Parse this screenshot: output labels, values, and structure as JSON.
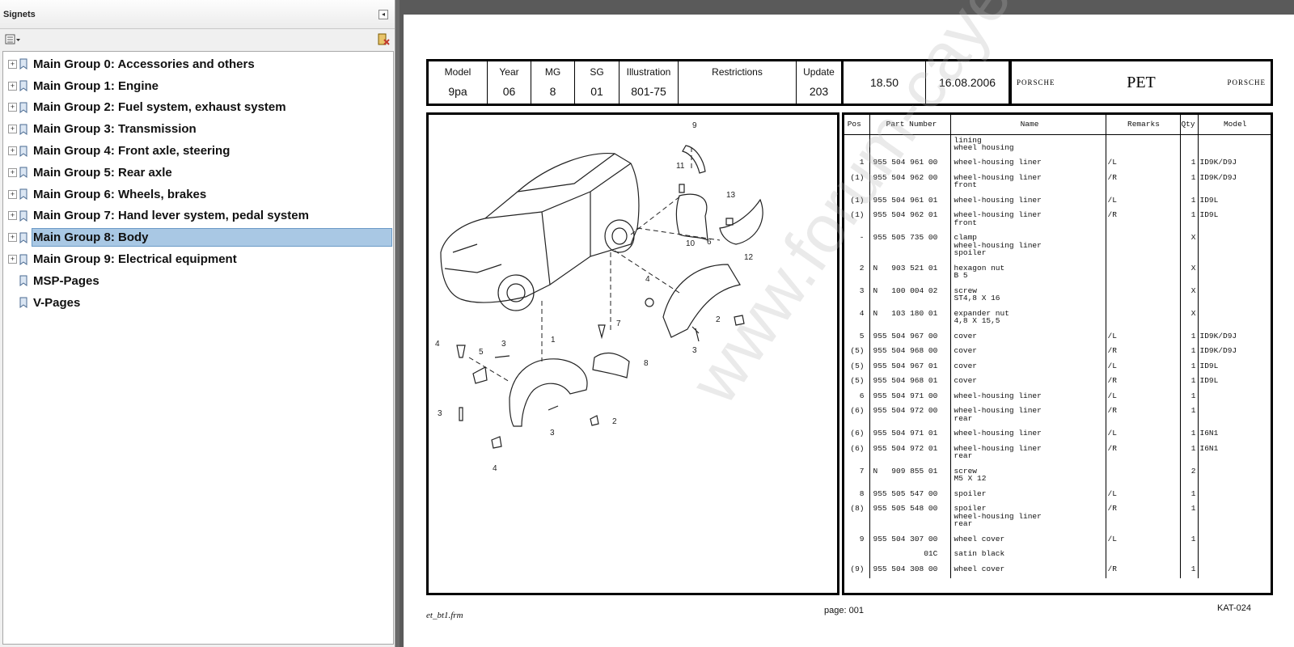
{
  "panel": {
    "title": "Signets",
    "collapse_glyph": "◂",
    "options_icon": "options-menu-icon",
    "delete_icon": "delete-bookmark-icon"
  },
  "bookmarks": [
    {
      "label": "Main Group 0: Accessories and others",
      "expandable": true,
      "selected": false
    },
    {
      "label": "Main Group 1: Engine",
      "expandable": true,
      "selected": false
    },
    {
      "label": "Main Group 2: Fuel system, exhaust system",
      "expandable": true,
      "selected": false
    },
    {
      "label": "Main Group 3: Transmission",
      "expandable": true,
      "selected": false
    },
    {
      "label": "Main Group 4: Front axle, steering",
      "expandable": true,
      "selected": false
    },
    {
      "label": "Main Group 5: Rear axle",
      "expandable": true,
      "selected": false
    },
    {
      "label": "Main Group 6: Wheels, brakes",
      "expandable": true,
      "selected": false
    },
    {
      "label": "Main Group 7: Hand lever system, pedal system",
      "expandable": true,
      "selected": false
    },
    {
      "label": "Main Group 8: Body",
      "expandable": true,
      "selected": true
    },
    {
      "label": "Main Group 9: Electrical equipment",
      "expandable": true,
      "selected": false
    },
    {
      "label": "MSP-Pages",
      "expandable": false,
      "selected": false
    },
    {
      "label": "V-Pages",
      "expandable": false,
      "selected": false
    }
  ],
  "header": {
    "model_label": "Model",
    "model": "9pa",
    "year_label": "Year",
    "year": "06",
    "mg_label": "MG",
    "mg": "8",
    "sg_label": "SG",
    "sg": "01",
    "illustration_label": "Illustration",
    "illustration": "801-75",
    "restrictions_label": "Restrictions",
    "restrictions": "",
    "update_label": "Update",
    "update": "203",
    "time": "18.50",
    "date": "16.08.2006",
    "brand_left": "PORSCHE",
    "title": "PET",
    "brand_right": "PORSCHE"
  },
  "parts_columns": [
    "Pos",
    "Part Number",
    "Name",
    "Remarks",
    "Qty",
    "Model"
  ],
  "parts": [
    {
      "pos": "",
      "pn": "",
      "name": "lining\nwheel housing",
      "rem": "",
      "qty": "",
      "model": ""
    },
    {
      "pos": "1",
      "pn": "955 504 961 00",
      "name": "wheel-housing liner",
      "rem": "/L",
      "qty": "1",
      "model": "ID9K/D9J"
    },
    {
      "pos": "(1)",
      "pn": "955 504 962 00",
      "name": "wheel-housing liner\nfront",
      "rem": "/R",
      "qty": "1",
      "model": "ID9K/D9J"
    },
    {
      "pos": "(1)",
      "pn": "955 504 961 01",
      "name": "wheel-housing liner",
      "rem": "/L",
      "qty": "1",
      "model": "ID9L"
    },
    {
      "pos": "(1)",
      "pn": "955 504 962 01",
      "name": "wheel-housing liner\nfront",
      "rem": "/R",
      "qty": "1",
      "model": "ID9L"
    },
    {
      "pos": "-",
      "pn": "955 505 735 00",
      "name": "clamp\nwheel-housing liner\nspoiler",
      "rem": "",
      "qty": "X",
      "model": ""
    },
    {
      "pos": "2",
      "pn": "N   903 521 01",
      "name": "hexagon nut\nB 5",
      "rem": "",
      "qty": "X",
      "model": ""
    },
    {
      "pos": "3",
      "pn": "N   100 004 02",
      "name": "screw\nST4,8 X 16",
      "rem": "",
      "qty": "X",
      "model": ""
    },
    {
      "pos": "4",
      "pn": "N   103 180 01",
      "name": "expander nut\n4,8 X 15,5",
      "rem": "",
      "qty": "X",
      "model": ""
    },
    {
      "pos": "5",
      "pn": "955 504 967 00",
      "name": "cover",
      "rem": "/L",
      "qty": "1",
      "model": "ID9K/D9J"
    },
    {
      "pos": "(5)",
      "pn": "955 504 968 00",
      "name": "cover",
      "rem": "/R",
      "qty": "1",
      "model": "ID9K/D9J"
    },
    {
      "pos": "(5)",
      "pn": "955 504 967 01",
      "name": "cover",
      "rem": "/L",
      "qty": "1",
      "model": "ID9L"
    },
    {
      "pos": "(5)",
      "pn": "955 504 968 01",
      "name": "cover",
      "rem": "/R",
      "qty": "1",
      "model": "ID9L"
    },
    {
      "pos": "6",
      "pn": "955 504 971 00",
      "name": "wheel-housing liner",
      "rem": "/L",
      "qty": "1",
      "model": ""
    },
    {
      "pos": "(6)",
      "pn": "955 504 972 00",
      "name": "wheel-housing liner\nrear",
      "rem": "/R",
      "qty": "1",
      "model": ""
    },
    {
      "pos": "(6)",
      "pn": "955 504 971 01",
      "name": "wheel-housing liner",
      "rem": "/L",
      "qty": "1",
      "model": "I6N1"
    },
    {
      "pos": "(6)",
      "pn": "955 504 972 01",
      "name": "wheel-housing liner\nrear",
      "rem": "/R",
      "qty": "1",
      "model": "I6N1"
    },
    {
      "pos": "7",
      "pn": "N   909 855 01",
      "name": "screw\nM5 X 12",
      "rem": "",
      "qty": "2",
      "model": ""
    },
    {
      "pos": "8",
      "pn": "955 505 547 00",
      "name": "spoiler",
      "rem": "/L",
      "qty": "1",
      "model": ""
    },
    {
      "pos": "(8)",
      "pn": "955 505 548 00",
      "name": "spoiler\nwheel-housing liner\nrear",
      "rem": "/R",
      "qty": "1",
      "model": ""
    },
    {
      "pos": "9",
      "pn": "955 504 307 00",
      "name": "wheel cover",
      "rem": "/L",
      "qty": "1",
      "model": ""
    },
    {
      "pos": "",
      "pn": "           01C",
      "name": "satin black",
      "rem": "",
      "qty": "",
      "model": ""
    },
    {
      "pos": "(9)",
      "pn": "955 504 308 00",
      "name": "wheel cover",
      "rem": "/R",
      "qty": "1",
      "model": ""
    }
  ],
  "callouts": [
    "9",
    "11",
    "13",
    "10",
    "6",
    "12",
    "4",
    "2",
    "3",
    "7",
    "1",
    "8",
    "4",
    "5",
    "3",
    "3",
    "2",
    "3",
    "4"
  ],
  "footer": {
    "left": "et_bt1.frm",
    "page": "page: 001",
    "right": "KAT-024"
  },
  "watermark": "www.forum-cayenne.com"
}
